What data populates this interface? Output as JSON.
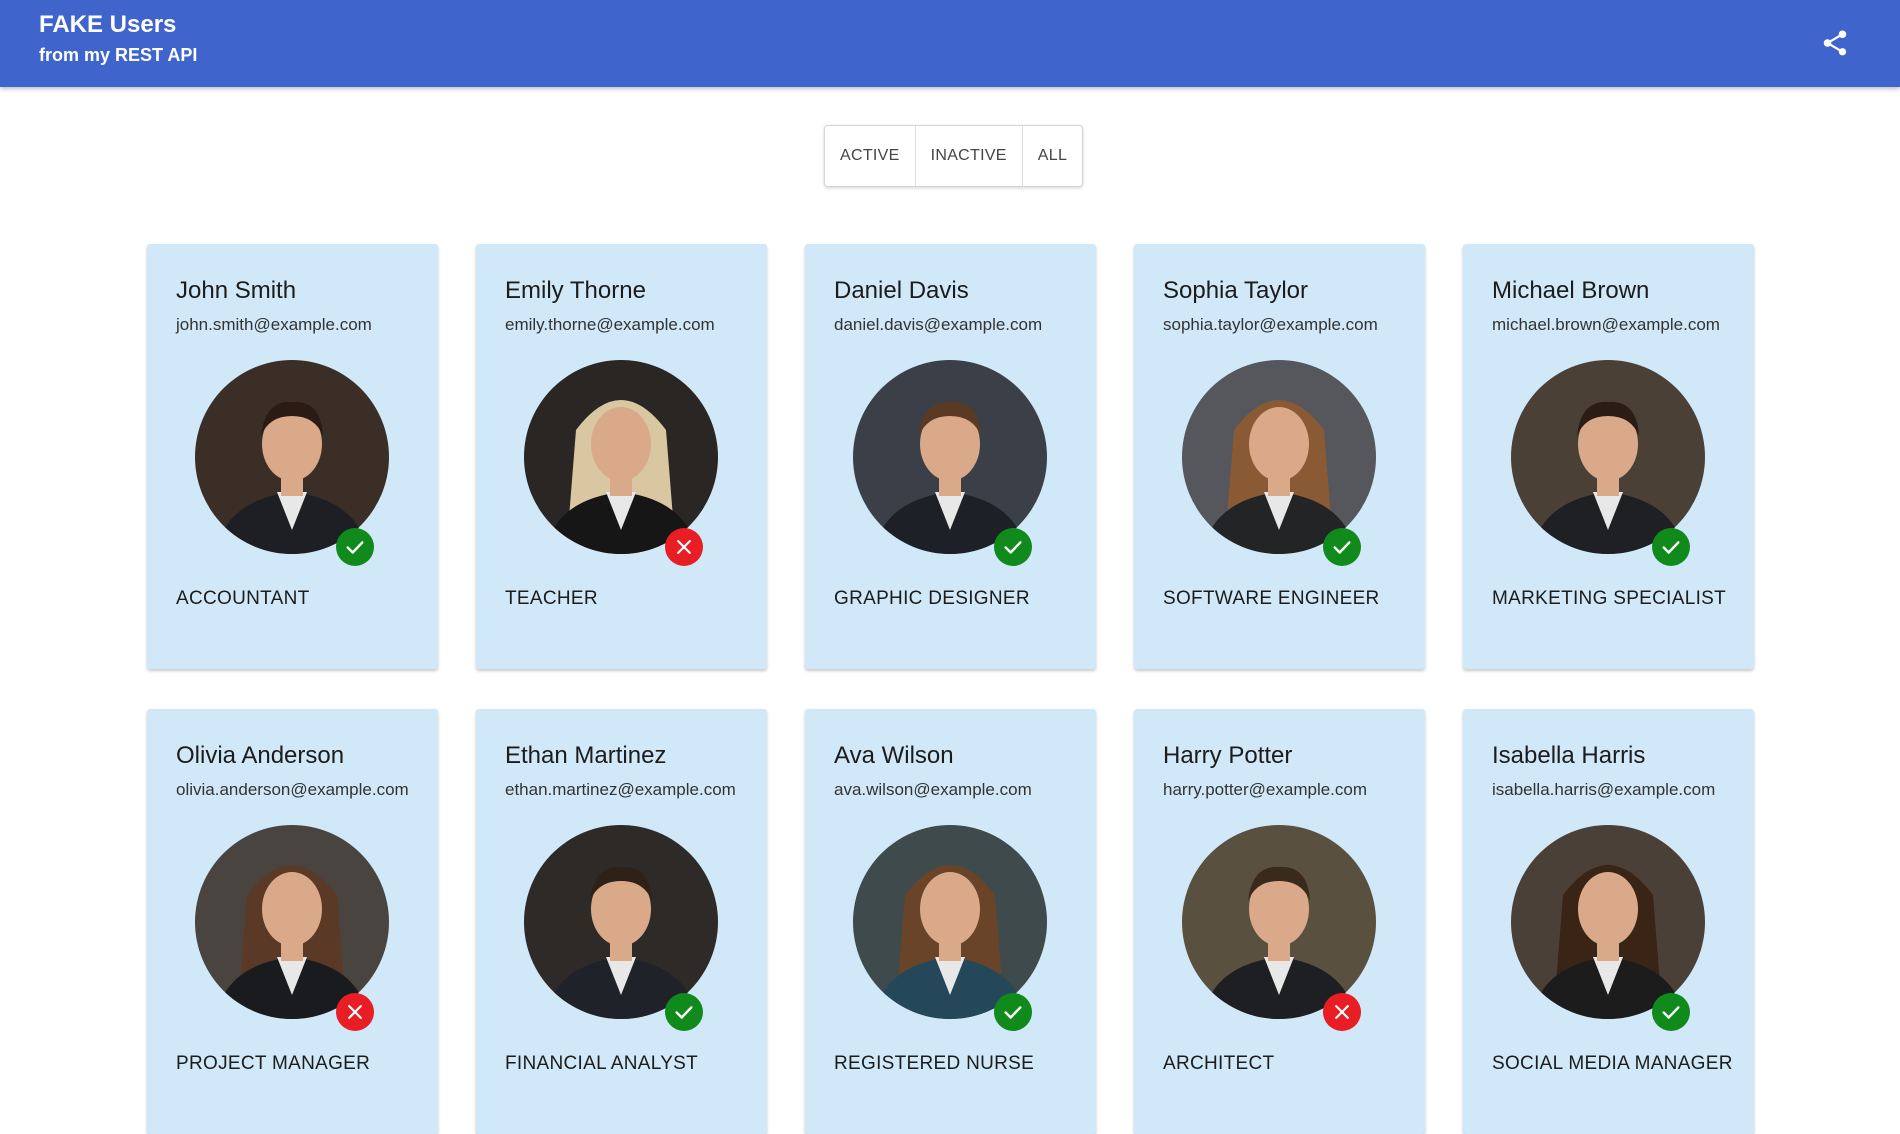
{
  "app": {
    "title": "FAKE Users",
    "subtitle": "from my REST API",
    "bar_color": "#3f65cc",
    "share_icon": "share-icon"
  },
  "filter": {
    "active_label": "ACTIVE",
    "inactive_label": "INACTIVE",
    "all_label": "ALL"
  },
  "colors": {
    "card_bg": "#d0e8f8",
    "active_badge": "#118a1c",
    "inactive_badge": "#e81e24"
  },
  "users": [
    {
      "name": "John Smith",
      "email": "john.smith@example.com",
      "role": "ACCOUNTANT",
      "status": "active"
    },
    {
      "name": "Emily Thorne",
      "email": "emily.thorne@example.com",
      "role": "TEACHER",
      "status": "inactive"
    },
    {
      "name": "Daniel Davis",
      "email": "daniel.davis@example.com",
      "role": "GRAPHIC DESIGNER",
      "status": "active"
    },
    {
      "name": "Sophia Taylor",
      "email": "sophia.taylor@example.com",
      "role": "SOFTWARE ENGINEER",
      "status": "active"
    },
    {
      "name": "Michael Brown",
      "email": "michael.brown@example.com",
      "role": "MARKETING SPECIALIST",
      "status": "active"
    },
    {
      "name": "Olivia Anderson",
      "email": "olivia.anderson@example.com",
      "role": "PROJECT MANAGER",
      "status": "inactive"
    },
    {
      "name": "Ethan Martinez",
      "email": "ethan.martinez@example.com",
      "role": "FINANCIAL ANALYST",
      "status": "active"
    },
    {
      "name": "Ava Wilson",
      "email": "ava.wilson@example.com",
      "role": "REGISTERED NURSE",
      "status": "active"
    },
    {
      "name": "Harry Potter",
      "email": "harry.potter@example.com",
      "role": "ARCHITECT",
      "status": "inactive"
    },
    {
      "name": "Isabella Harris",
      "email": "isabella.harris@example.com",
      "role": "SOCIAL MEDIA MANAGER",
      "status": "active"
    }
  ]
}
